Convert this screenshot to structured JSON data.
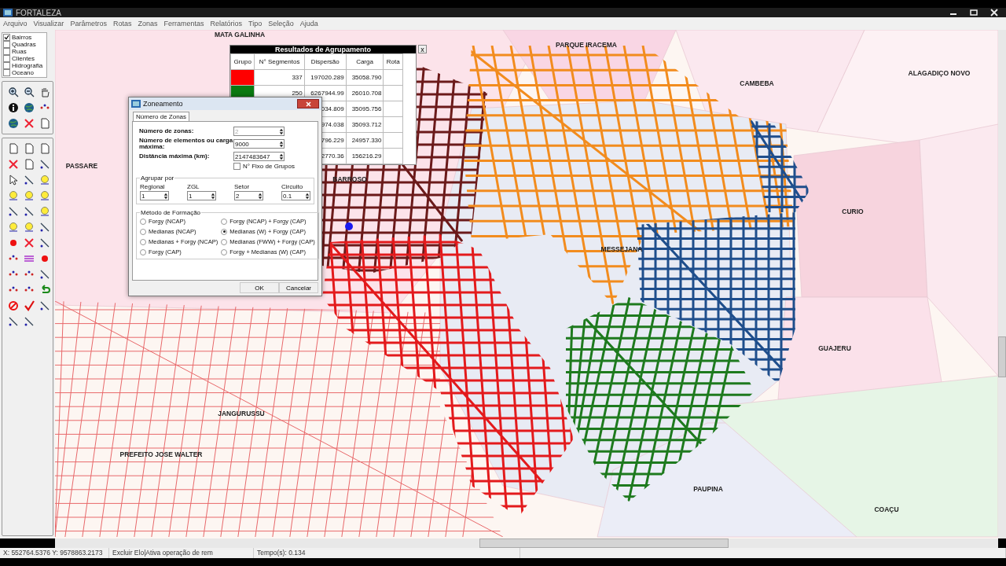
{
  "window": {
    "title": "FORTALEZA"
  },
  "menu": [
    "Arquivo",
    "Visualizar",
    "Parâmetros",
    "Rotas",
    "Zonas",
    "Ferramentas",
    "Relatórios",
    "Tipo",
    "Seleção",
    "Ajuda"
  ],
  "layers": [
    {
      "label": "Bairros",
      "checked": true
    },
    {
      "label": "Quadras",
      "checked": false
    },
    {
      "label": "Ruas",
      "checked": false
    },
    {
      "label": "Clientes",
      "checked": false
    },
    {
      "label": "Hidrografia",
      "checked": false
    },
    {
      "label": "Oceano",
      "checked": false
    }
  ],
  "map": {
    "labels": [
      "MATA GALINHA",
      "PARQUE IRACEMA",
      "CAMBEBA",
      "ALAGADIÇO NOVO",
      "PASSARE",
      "BARROSO",
      "CURIO",
      "MESSEJANA",
      "GUAJERU",
      "JANGURUSSU",
      "PREFEITO JOSE WALTER",
      "PAUPINA",
      "COAÇU"
    ]
  },
  "results": {
    "title": "Resultados de Agrupamento",
    "close": "x",
    "columns": [
      "Grupo",
      "N° Segmentos",
      "Dispersão",
      "Carga",
      "Rota"
    ],
    "rows": [
      {
        "color": "#ff0000",
        "segments": "337",
        "dispersion": "197020.289",
        "load": "35058.790"
      },
      {
        "color": "#0a7a12",
        "segments": "250",
        "dispersion": "6267944.99",
        "load": "26010.708"
      },
      {
        "dispersion": "034.809",
        "load": "35095.756"
      },
      {
        "dispersion": "974.038",
        "load": "35093.712"
      },
      {
        "dispersion": "796.229",
        "load": "24957.330"
      },
      {
        "dispersion": "2770.36",
        "load": "156216.29"
      }
    ]
  },
  "dialog": {
    "title": "Zoneamento",
    "tab": "Número de Zonas",
    "fields": [
      {
        "label": "Número de zonas:",
        "value": "2",
        "disabled": true
      },
      {
        "label": "Número de elementos ou carga máxima:",
        "value": "9000",
        "disabled": false
      },
      {
        "label": "Distância máxima (km):",
        "value": "2147483647",
        "disabled": false
      }
    ],
    "fixed_groups": {
      "label": "N° Fixo de Grupos",
      "checked": false
    },
    "group_by": {
      "title": "Agrupar por",
      "fields": [
        {
          "label": "Regional",
          "value": "1"
        },
        {
          "label": "ZGL",
          "value": "1"
        },
        {
          "label": "Setor",
          "value": "2"
        },
        {
          "label": "Circuito",
          "value": "0.1"
        }
      ]
    },
    "method": {
      "title": "Método de Formação",
      "options": [
        {
          "label": "Forgy (NCAP)",
          "selected": false
        },
        {
          "label": "Forgy (NCAP) + Forgy (CAP)",
          "selected": false
        },
        {
          "label": "Medianas (NCAP)",
          "selected": false
        },
        {
          "label": "Medianas (W) + Forgy (CAP)",
          "selected": true
        },
        {
          "label": "Medianas + Forgy (NCAP)",
          "selected": false
        },
        {
          "label": "Medianas (FWW) + Forgy (CAP)",
          "selected": false
        },
        {
          "label": "Forgy (CAP)",
          "selected": false
        },
        {
          "label": "Forgy + Medianas (W) (CAP)",
          "selected": false
        }
      ]
    },
    "buttons": [
      "OK",
      "Cancelar"
    ]
  },
  "status_bar": [
    "X: 552764.5376 Y: 9578863.2173",
    "Excluir Elo|Ativa operação de rem",
    "Tempo(s): 0.134"
  ]
}
